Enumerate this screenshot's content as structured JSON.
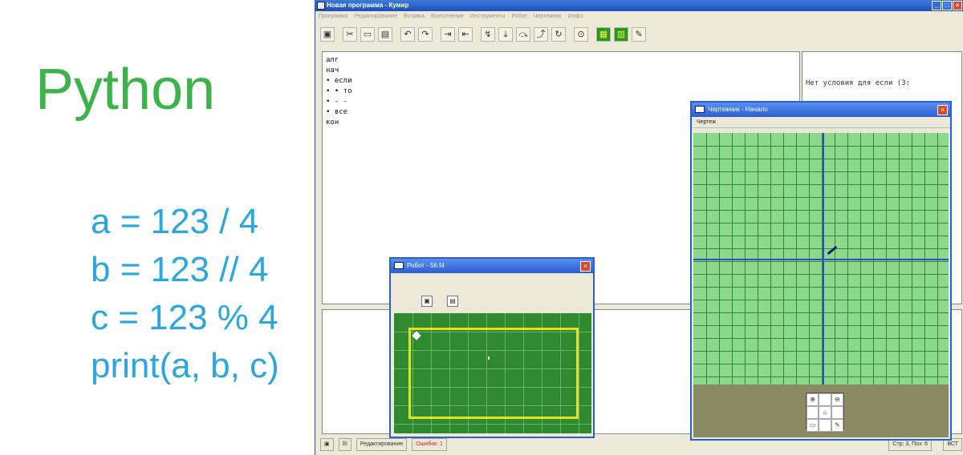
{
  "caption": {
    "title": "Python",
    "code_lines": [
      "a = 123 / 4",
      "b = 123 // 4",
      "c = 123 % 4",
      "print(a, b, c)"
    ]
  },
  "kumir": {
    "title": "Новая программа - Кумир",
    "menu": [
      "Программа",
      "Редактирование",
      "Вставка",
      "Выполнение",
      "Инструменты",
      "Робот",
      "Чертежник",
      "Инфо"
    ],
    "editor_lines": [
      "алг",
      "нач",
      "• если",
      "• • то",
      "• - -",
      "• все",
      "кон"
    ],
    "margin_message": "Нет условия для если  (3:",
    "status": {
      "mode": "Редактирование",
      "errors": "Ошибок: 1",
      "position": "Стр: 3, Поз: 6",
      "insert_mode": "ВСТ"
    }
  },
  "robot_window": {
    "title": "Робот - 56.f4"
  },
  "drawer_window": {
    "title": "Чертежник - Начало",
    "menu_label": "Чертеж"
  },
  "colors": {
    "caption_green": "#3cb44b",
    "code_blue": "#2aa7e0",
    "robot_field": "#2f8a2f",
    "robot_wall": "#e6e01e",
    "drawer_field": "#8ed88e",
    "drawer_axis": "#2a4fcc"
  }
}
